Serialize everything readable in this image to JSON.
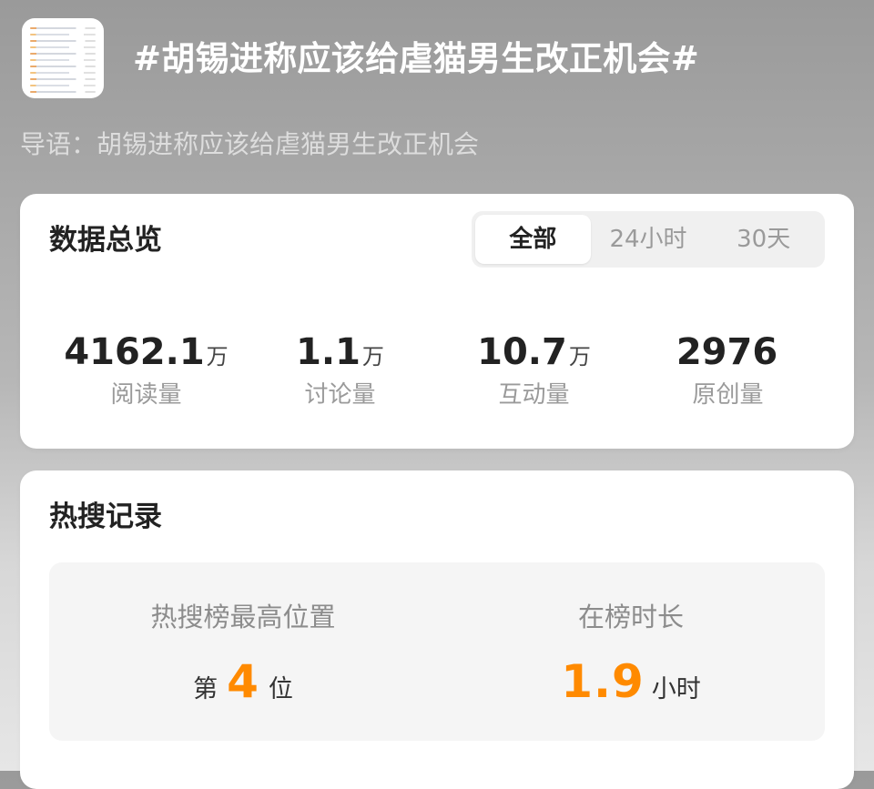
{
  "topic": {
    "thumbnail_icon": "weibo-post-thumbnail",
    "title": "#胡锡进称应该给虐猫男生改正机会#",
    "intro": "导语：胡锡进称应该给虐猫男生改正机会"
  },
  "overview": {
    "title": "数据总览",
    "tabs": [
      {
        "label": "全部",
        "active": true
      },
      {
        "label": "24小时",
        "active": false
      },
      {
        "label": "30天",
        "active": false
      }
    ],
    "stats": [
      {
        "value": "4162.1",
        "unit": "万",
        "label": "阅读量"
      },
      {
        "value": "1.1",
        "unit": "万",
        "label": "讨论量"
      },
      {
        "value": "10.7",
        "unit": "万",
        "label": "互动量"
      },
      {
        "value": "2976",
        "unit": "",
        "label": "原创量"
      }
    ]
  },
  "hot_search": {
    "title": "热搜记录",
    "highest_position": {
      "label": "热搜榜最高位置",
      "prefix": "第",
      "value": "4",
      "suffix": "位"
    },
    "duration": {
      "label": "在榜时长",
      "value": "1.9",
      "unit": "小时"
    }
  },
  "colors": {
    "accent": "#ff8a00",
    "card_background": "#ffffff",
    "muted_text": "#9a9a9a"
  }
}
